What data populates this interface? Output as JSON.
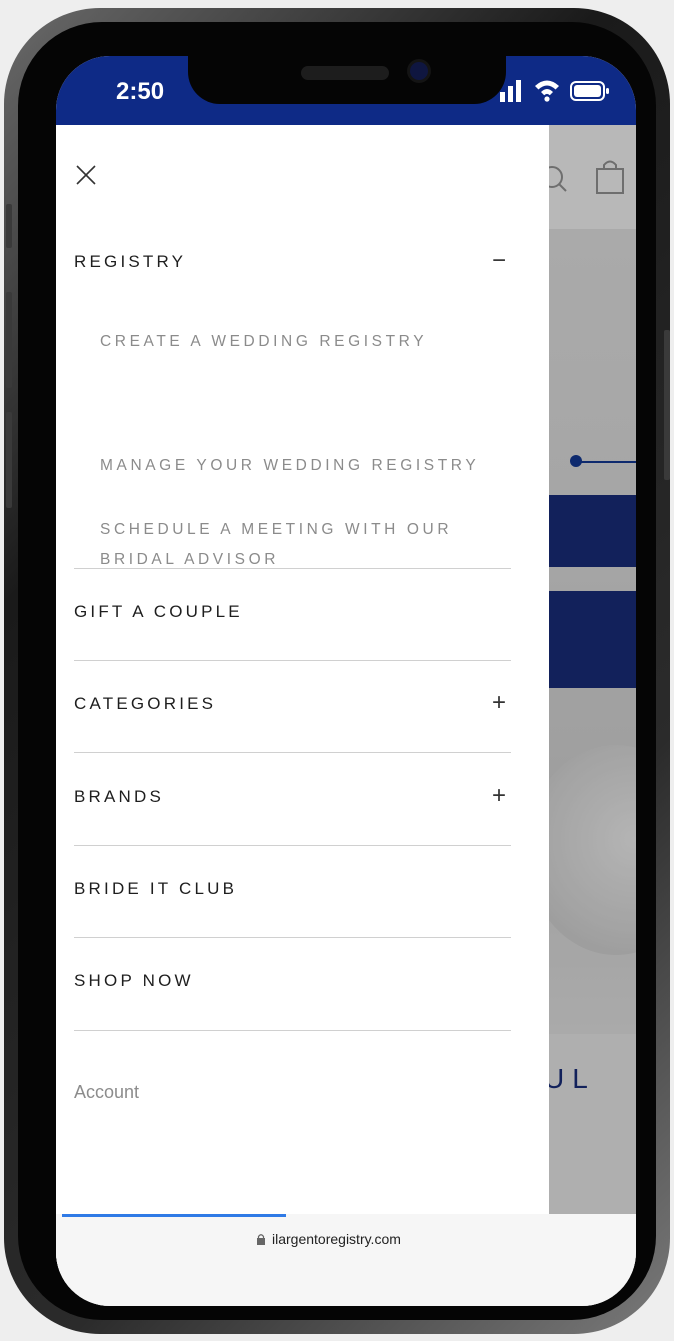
{
  "status_bar": {
    "time": "2:50"
  },
  "menu": {
    "close_icon": "close-icon",
    "registry": {
      "label": "REGISTRY",
      "toggle": "−",
      "subitems": [
        {
          "label": "CREATE A WEDDING REGISTRY"
        },
        {
          "label": "MANAGE YOUR WEDDING REGISTRY"
        },
        {
          "line1": "SCHEDULE A MEETING WITH OUR",
          "line2": "BRIDAL ADVISOR"
        }
      ]
    },
    "items": [
      {
        "label": "GIFT A COUPLE",
        "toggle": ""
      },
      {
        "label": "CATEGORIES",
        "toggle": "+"
      },
      {
        "label": "BRANDS",
        "toggle": "+"
      },
      {
        "label": "BRIDE IT CLUB",
        "toggle": ""
      },
      {
        "label": "SHOP NOW",
        "toggle": ""
      }
    ],
    "account_label": "Account"
  },
  "background_page": {
    "partial_heading": "UL"
  },
  "browser": {
    "url": "ilargentoregistry.com"
  },
  "colors": {
    "brand_navy": "#0e2a86",
    "progress_blue": "#2f7ae6",
    "callout": "#0e2a6e"
  }
}
